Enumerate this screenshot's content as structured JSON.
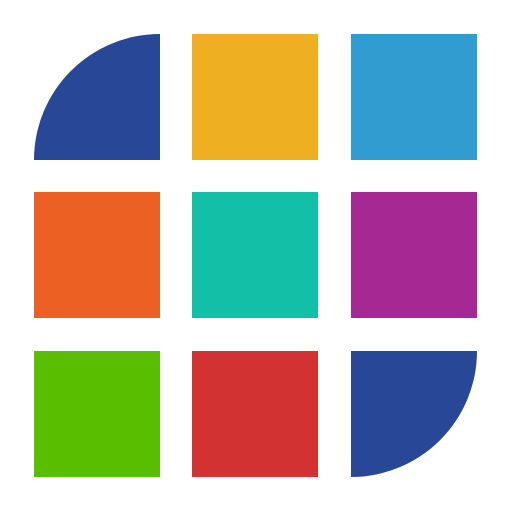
{
  "logo": {
    "tiles": [
      {
        "name": "tile-top-left-quarter-circle",
        "color": "#284796",
        "shape": "quarter-circle"
      },
      {
        "name": "tile-top-middle",
        "color": "#EFAF22",
        "shape": "square"
      },
      {
        "name": "tile-top-right",
        "color": "#309CD0",
        "shape": "square"
      },
      {
        "name": "tile-middle-left",
        "color": "#EC6123",
        "shape": "square"
      },
      {
        "name": "tile-center",
        "color": "#13BFA6",
        "shape": "square"
      },
      {
        "name": "tile-middle-right",
        "color": "#A62893",
        "shape": "square"
      },
      {
        "name": "tile-bottom-left",
        "color": "#59BE00",
        "shape": "square"
      },
      {
        "name": "tile-bottom-middle",
        "color": "#D33232",
        "shape": "square"
      },
      {
        "name": "tile-bottom-right-quarter-circle",
        "color": "#284796",
        "shape": "quarter-circle"
      }
    ]
  }
}
